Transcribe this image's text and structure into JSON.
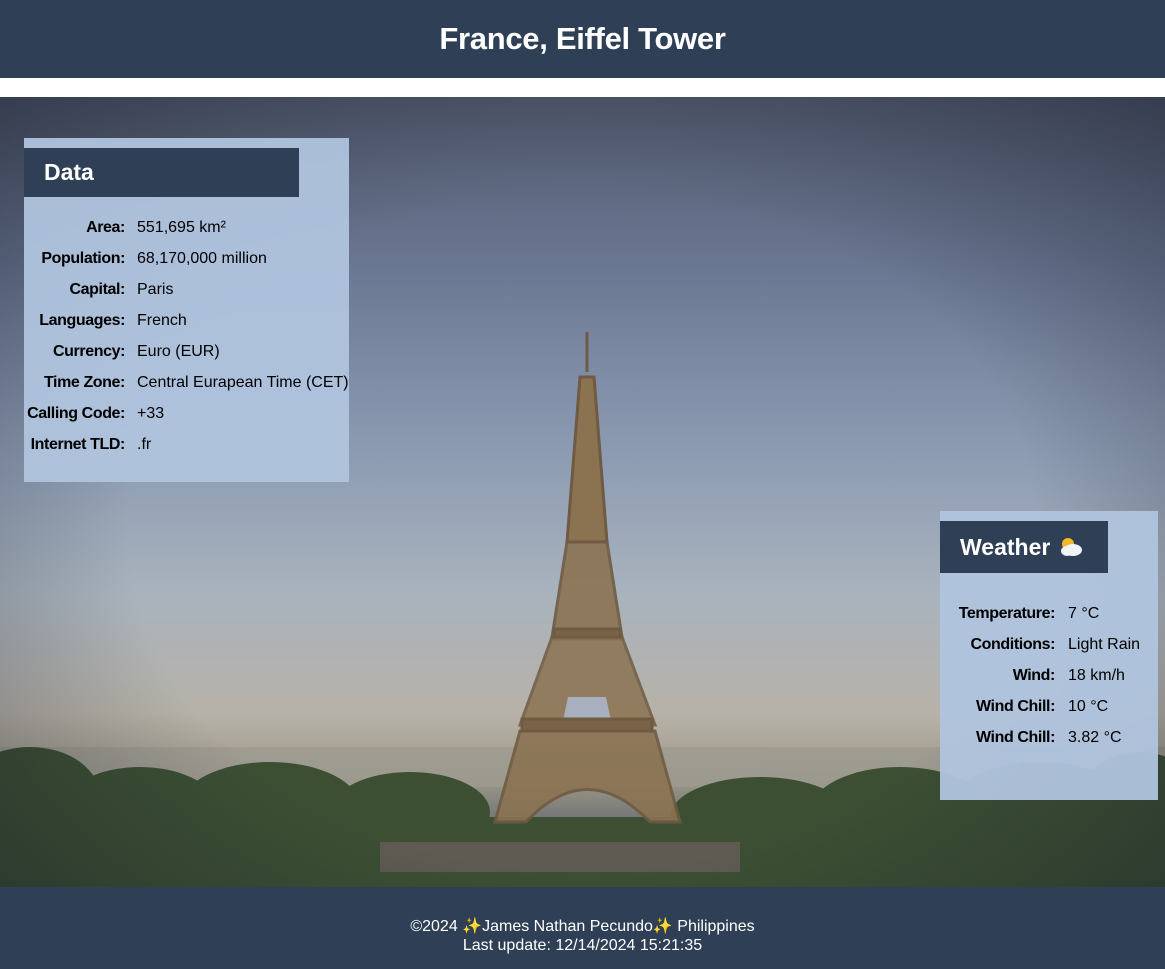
{
  "header": {
    "title": "France, Eiffel Tower"
  },
  "data_panel": {
    "heading": "Data",
    "rows": [
      {
        "label": "Area:",
        "value": "551,695 km²"
      },
      {
        "label": "Population:",
        "value": "68,170,000 million"
      },
      {
        "label": "Capital:",
        "value": "Paris"
      },
      {
        "label": "Languages:",
        "value": "French"
      },
      {
        "label": "Currency:",
        "value": "Euro (EUR)"
      },
      {
        "label": "Time Zone:",
        "value": "Central Eurapean Time (CET)"
      },
      {
        "label": "Calling Code:",
        "value": "+33"
      },
      {
        "label": "Internet TLD:",
        "value": ".fr"
      }
    ]
  },
  "weather_panel": {
    "heading": "Weather",
    "icon": "sun-behind-cloud-icon",
    "rows": [
      {
        "label": "Temperature:",
        "value": "7 °C"
      },
      {
        "label": "Conditions:",
        "value": "Light Rain"
      },
      {
        "label": "Wind:",
        "value": "18 km/h"
      },
      {
        "label": "Wind Chill:",
        "value": "10 °C"
      },
      {
        "label": "Wind Chill:",
        "value": "3.82 °C"
      }
    ]
  },
  "footer": {
    "copyright": "©2024",
    "author": "James Nathan Pecundo",
    "country": "Philippines",
    "last_update_label": "Last update:",
    "last_update_value": "12/14/2024 15:21:35"
  },
  "colors": {
    "header_bg": "#2e3f56",
    "panel_bg": "#b0c4de"
  }
}
